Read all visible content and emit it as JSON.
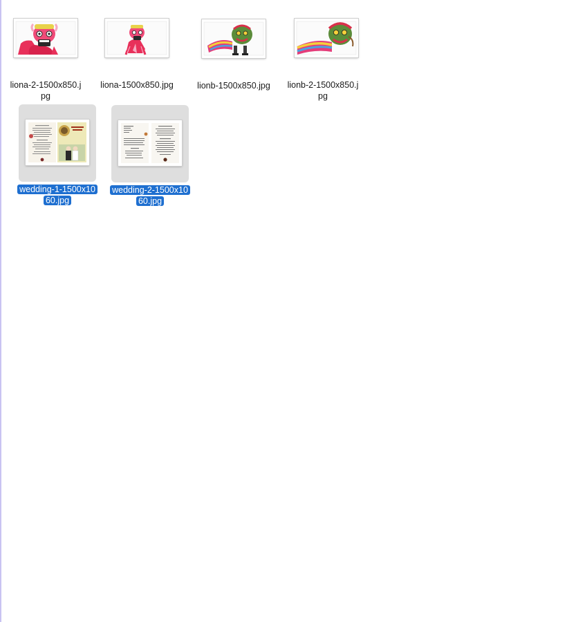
{
  "files": [
    {
      "name": "liona-2-1500x850.jpg",
      "label_line1": "liona-2-1500x850.j",
      "label_line2": "pg",
      "selected": false,
      "icon": "red-lion-dance-image-icon"
    },
    {
      "name": "liona-1500x850.jpg",
      "label_line1": "liona-1500x850.jpg",
      "label_line2": "",
      "selected": false,
      "icon": "red-lion-dance-image-icon"
    },
    {
      "name": "lionb-1500x850.jpg",
      "label_line1": "lionb-1500x850.jpg",
      "label_line2": "",
      "selected": false,
      "icon": "green-lion-dance-image-icon"
    },
    {
      "name": "lionb-2-1500x850.jpg",
      "label_line1": "lionb-2-1500x850.j",
      "label_line2": "pg",
      "selected": false,
      "icon": "green-lion-dance-image-icon"
    },
    {
      "name": "wedding-1-1500x1060.jpg",
      "label_line1": "wedding-1-1500x10",
      "label_line2": "60.jpg",
      "selected": true,
      "icon": "wedding-invitation-image-icon"
    },
    {
      "name": "wedding-2-1500x1060.jpg",
      "label_line1": "wedding-2-1500x10",
      "label_line2": "60.jpg",
      "selected": true,
      "icon": "wedding-menu-image-icon"
    }
  ],
  "colors": {
    "selection_highlight": "#1e6fd0",
    "selected_tile_bg": "#dedede",
    "window_left_border": "#c9c3f2"
  }
}
